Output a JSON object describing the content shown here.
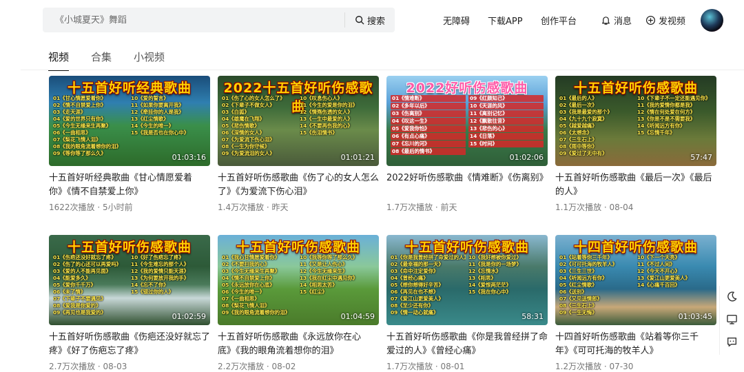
{
  "search": {
    "placeholder": "《小城夏天》舞蹈",
    "button_label": "搜索"
  },
  "nav": {
    "accessibility": "无障碍",
    "download": "下载APP",
    "creator": "创作平台",
    "messages": "消息",
    "upload": "发视频"
  },
  "tabs": [
    {
      "label": "视频",
      "active": true
    },
    {
      "label": "合集",
      "active": false
    },
    {
      "label": "小视频",
      "active": false
    }
  ],
  "videos": [
    {
      "thumb_title": "十五首好听经典歌曲",
      "duration": "01:03:16",
      "songs": [
        "01《甘心情愿爱着你》",
        "10《爱的誓言》",
        "02《情不自禁爱上你》",
        "11《如果你要离开我》",
        "03《走天涯》",
        "12《牵挂你的人是我》",
        "04《爱的世界只有你》",
        "13《红尘情歌》",
        "05《今生无缘来生再聚》",
        "14《今生的唯一》",
        "06《一曲相思》",
        "15《我是否也在你心中》",
        "07《梨花飞情人泪》",
        "",
        "08《我的眼角流着想你的泪》",
        "",
        "09《等你等了那么久》",
        ""
      ],
      "title": "十五首好听经典歌曲《甘心情愿爱着你》《情不自禁爱上你》",
      "meta": "1622次播放 · 5小时前"
    },
    {
      "thumb_title": "2022十五首好听伤感歌曲",
      "duration": "01:01:21",
      "songs": [
        "01《伤了心的女人怎么了》",
        "10《叹息伤心人》",
        "02《下辈子不做女人》",
        "11《今生的爱是你的泪》",
        "03《白狐》",
        "12《情殇伤透的女人》",
        "04《雄鹰在飞翔》",
        "13《一生中最爱的人》",
        "05《悲伤情歌》",
        "14《不要再伤我的心》",
        "06《深情的女人》",
        "15《伤泪情书》",
        "07《为爱流下伤心泪》",
        "",
        "08《一生为你守候》",
        "",
        "09《为爱流泪的女人》",
        ""
      ],
      "title": "十五首好听伤感歌曲《伤了心的女人怎么了》《为爱流下伤心泪》",
      "meta": "1.4万次播放 · 昨天"
    },
    {
      "thumb_title": "2022好听伤感歌曲",
      "duration": "01:02:06",
      "songs": [
        "01《情难断》",
        "09《红颜知己》",
        "02《多年以后》",
        "10《天涯的风》",
        "03《伤离别》",
        "11《离别记忆》",
        "04《叹这一生》",
        "12《飘散往昔》",
        "05《爱我你怕》",
        "13《悲伤的心》",
        "06《有点心痛》",
        "14《日落》",
        "07《忘川的河》",
        "15《时间》",
        "08《最后的情书》",
        "",
        ""
      ],
      "title": "2022好听伤感歌曲《情难断》《伤离别》",
      "meta": "1.7万次播放 · 前天"
    },
    {
      "thumb_title": "十五首好听伤感歌曲",
      "duration": "57:47",
      "songs": [
        "01《最后的人》",
        "10《下辈子不一定还能遇见你》",
        "02《最后一次》",
        "11《我的爱情你都是我》",
        "03《我是最爱的那个》",
        "12《情在何处爱在何方》",
        "04《九十九个寂寞》",
        "13《你是不是不需要我》",
        "05《越爱越痛》",
        "14《听闻远方有你》",
        "06《太想念》",
        "15《忘情千年》",
        "07《三生石上》",
        "",
        "08《雨中等你》",
        "",
        "09《爱过了无中有》",
        ""
      ],
      "title": "十五首好听伤感歌曲《最后一次》《最后的人》",
      "meta": "1.1万次播放 · 08-04"
    },
    {
      "thumb_title": "十五首好听伤感歌曲",
      "duration": "01:02:59",
      "songs": [
        "01《伤疤还没好就忘了疼》",
        "10《好了伤疤忘了疼》",
        "02《伤了的心还可以再爱吗》",
        "11《今生难忘的那个人》",
        "03《爱的人不能再见面》",
        "12《我的爱情只能天涯》",
        "04《能爱多久》",
        "13《为何要放开我的手》",
        "05《爱你千千万》",
        "14《忘不了你》",
        "06《未了情》",
        "15《错过你的人》",
        "07《下辈子不要遇见》",
        "",
        "08《爱我是你爱的》",
        "",
        "09《再见也是我爱的》",
        ""
      ],
      "title": "十五首好听伤感歌曲《伤疤还没好就忘了疼》《好了伤疤忘了疼》",
      "meta": "2.7万次播放 · 08-03"
    },
    {
      "thumb_title": "十五首好听伤感歌曲",
      "duration": "01:04:59",
      "songs": [
        "01《我心甘情愿爱着你》",
        "10《我等你等了那么久》",
        "02《不要扫我的心》",
        "11《又是让人伤心》",
        "03《今生无缘来生再聚》",
        "12《今生无缘来生》",
        "04《情不自禁爱上你》",
        "13《我在红尘中遇见你》",
        "05《永远放你在心底》",
        "14《相思太苦》",
        "06《今生的唯一》",
        "15《红尘》",
        "07《一曲相思》",
        "",
        "08《梨花飞情人泪》",
        "",
        "09《我的眼角流着想你的泪》",
        ""
      ],
      "title": "十五首好听伤感歌曲《永远放你在心底》《我的眼角流着想你的泪》",
      "meta": "2.2万次播放 · 08-02"
    },
    {
      "thumb_title": "十五首好听伤感歌曲",
      "duration": "58:31",
      "songs": [
        "01《你是我曾经拼了命爱过的人》",
        "10《我好想被你爱过》",
        "02《最幸福的那一天》",
        "11《我是你的一场梦》",
        "03《命中注定爱你》",
        "12《忘情水》",
        "04《曾经心痛》",
        "13《相思》",
        "05《想你想得好辛苦》",
        "14《爱恨两茫茫》",
        "06《再见在也不想》",
        "15《我在你心中》",
        "07《爱江山更爱美人》",
        "",
        "08《至少还有你》",
        "",
        "09《情一动心就痛》",
        ""
      ],
      "title": "十五首好听伤感歌曲《你是我曾经拼了命爱过的人》《曾经心痛》",
      "meta": "1.7万次播放 · 08-01"
    },
    {
      "thumb_title": "十四首好听伤感歌曲",
      "duration": "01:03:45",
      "songs": [
        "01《站着等你三千年》",
        "10《下一个天亮》",
        "02《可可托海的牧羊人》",
        "11《不过人间》",
        "03《三生三世》",
        "12《今天不开心》",
        "04《听闻远方有你》",
        "13《爱江山更爱美人》",
        "05《红尘情歌》",
        "14《心痛千百回》",
        "06《送别》",
        "",
        "07《又见送情郎》",
        "",
        "08《三生石上》",
        "",
        "09《一生无悔》",
        ""
      ],
      "title": "十四首好听伤感歌曲《站着等你三千年》《可可托海的牧羊人》",
      "meta": "1.2万次播放 · 07-30"
    }
  ]
}
